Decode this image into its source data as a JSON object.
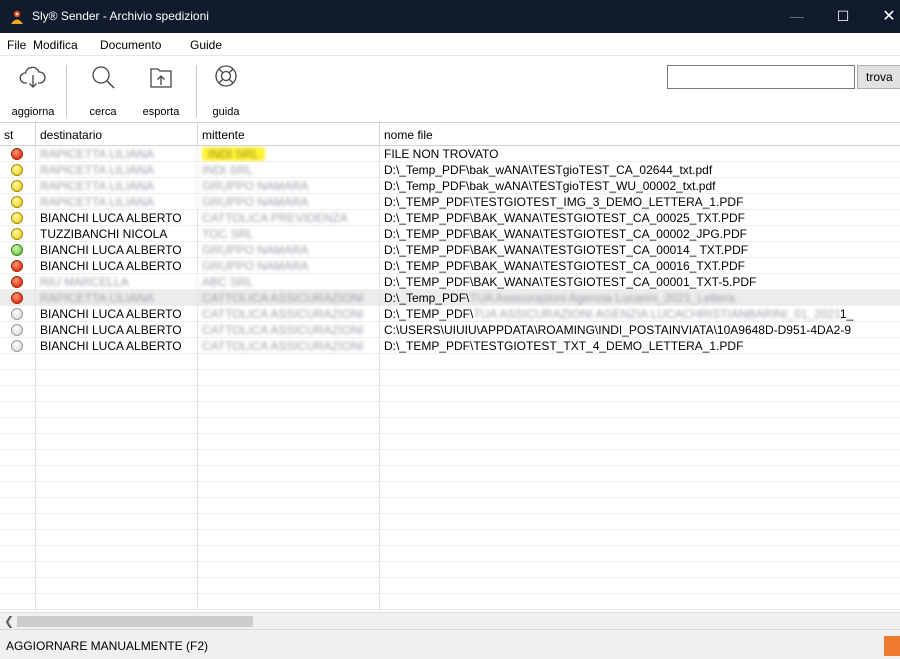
{
  "window": {
    "title": "Sly® Sender - Archivio spedizioni"
  },
  "menu": [
    "File",
    "Modifica",
    "Documento",
    "Guide"
  ],
  "toolbar": {
    "refresh_label": "aggiorna",
    "search_label": "cerca",
    "export_label": "esporta",
    "help_label": "guida",
    "search_value": "",
    "find_label": "trova"
  },
  "columns": {
    "st": "st",
    "dest": "destinatario",
    "mitt": "mittente",
    "file": "nome file"
  },
  "rows": [
    {
      "status": "red",
      "dest": "RAPICETTA LILIANA",
      "mitt": "INDI SRL",
      "file": "FILE NON TROVATO"
    },
    {
      "status": "yellow",
      "dest": "RAPICETTA LILIANA",
      "mitt": "INDI SRL",
      "file": "D:\\_Temp_PDF\\bak_wANA\\TESTgioTEST_CA_02644_txt.pdf"
    },
    {
      "status": "yellow",
      "dest": "RAPICETTA LILIANA",
      "mitt": "GRUPPO NAMARA",
      "file": "D:\\_Temp_PDF\\bak_wANA\\TESTgioTEST_WU_00002_txt.pdf"
    },
    {
      "status": "yellow",
      "dest": "RAPICETTA LILIANA",
      "mitt": "GRUPPO NAMARA",
      "file": "D:\\_TEMP_PDF\\TESTGIOTEST_IMG_3_DEMO_LETTERA_1.PDF"
    },
    {
      "status": "yellow",
      "dest": "BIANCHI LUCA ALBERTO",
      "mitt": "CATTOLICA PREVIDENZA",
      "file": "D:\\_TEMP_PDF\\BAK_WANA\\TESTGIOTEST_CA_00025_TXT.PDF"
    },
    {
      "status": "yellow",
      "dest": "TUZZIBANCHI NICOLA",
      "mitt": "TOC SRL",
      "file": "D:\\_TEMP_PDF\\BAK_WANA\\TESTGIOTEST_CA_00002_JPG.PDF"
    },
    {
      "status": "green",
      "dest": "BIANCHI LUCA ALBERTO",
      "mitt": "GRUPPO NAMARA",
      "file": "D:\\_TEMP_PDF\\BAK_WANA\\TESTGIOTEST_CA_00014_ TXT.PDF"
    },
    {
      "status": "red",
      "dest": "BIANCHI LUCA ALBERTO",
      "mitt": "GRUPPO NAMARA",
      "file": "D:\\_TEMP_PDF\\BAK_WANA\\TESTGIOTEST_CA_00016_TXT.PDF"
    },
    {
      "status": "red",
      "dest": "RIU MARCELLA",
      "mitt": "ABC SRL",
      "file": "D:\\_TEMP_PDF\\BAK_WANA\\TESTGIOTEST_CA_00001_TXT-5.PDF"
    },
    {
      "status": "red",
      "dest": "RAPICETTA LILIANA",
      "mitt": "CATTOLICA ASSICURAZIONI",
      "file": "D:\\_Temp_PDF\\",
      "file_hidden": "TUA Assicurazioni Agenzia Lucarini_2021_Lettera"
    },
    {
      "status": "gray",
      "dest": "BIANCHI LUCA ALBERTO",
      "mitt": "CATTOLICA ASSICURAZIONI",
      "file": "D:\\_TEMP_PDF\\",
      "file_hidden": "TUA ASSICURAZIONI AGENZIA LUCACHRISTIANBARINI_01_2021",
      "file_tail": "1_"
    },
    {
      "status": "gray",
      "dest": "BIANCHI LUCA ALBERTO",
      "mitt": "CATTOLICA ASSICURAZIONI",
      "file": "C:\\USERS\\UIUIU\\APPDATA\\ROAMING\\INDI_POSTAINVIATA\\10A9648D-D951-4DA2-9"
    },
    {
      "status": "gray",
      "dest": "BIANCHI LUCA ALBERTO",
      "mitt": "CATTOLICA ASSICURAZIONI",
      "file": "D:\\_TEMP_PDF\\TESTGIOTEST_TXT_4_DEMO_LETTERA_1.PDF"
    }
  ],
  "status_bar": {
    "text": "AGGIORNARE MANUALMENTE (F2)"
  },
  "colors": {
    "titlebar": "#111b2e",
    "status_indicator": "#f07a2e",
    "highlight": "#fff233"
  }
}
